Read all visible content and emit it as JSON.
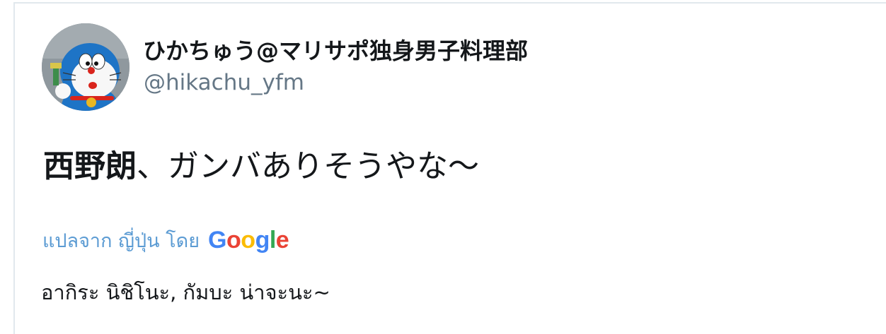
{
  "author": {
    "display_name": "ひかちゅう@マリサポ独身男子料理部",
    "handle": "@hikachu_yfm"
  },
  "tweet": {
    "text_bold": "西野朗",
    "text_rest": "、ガンバありそうやな〜"
  },
  "translation": {
    "label": "แปลจาก ญี่ปุ่น โดย",
    "provider_letters": [
      "G",
      "o",
      "o",
      "g",
      "l",
      "e"
    ],
    "provider_colors": [
      "#4285F4",
      "#EA4335",
      "#FBBC05",
      "#4285F4",
      "#34A853",
      "#EA4335"
    ],
    "translated_text": "อากิระ นิชิโนะ, กัมบะ น่าจะนะ~"
  },
  "colors": {
    "link": "#5b9bd3",
    "handle": "#657786",
    "text": "#14171a",
    "border": "#e1e8ed"
  }
}
